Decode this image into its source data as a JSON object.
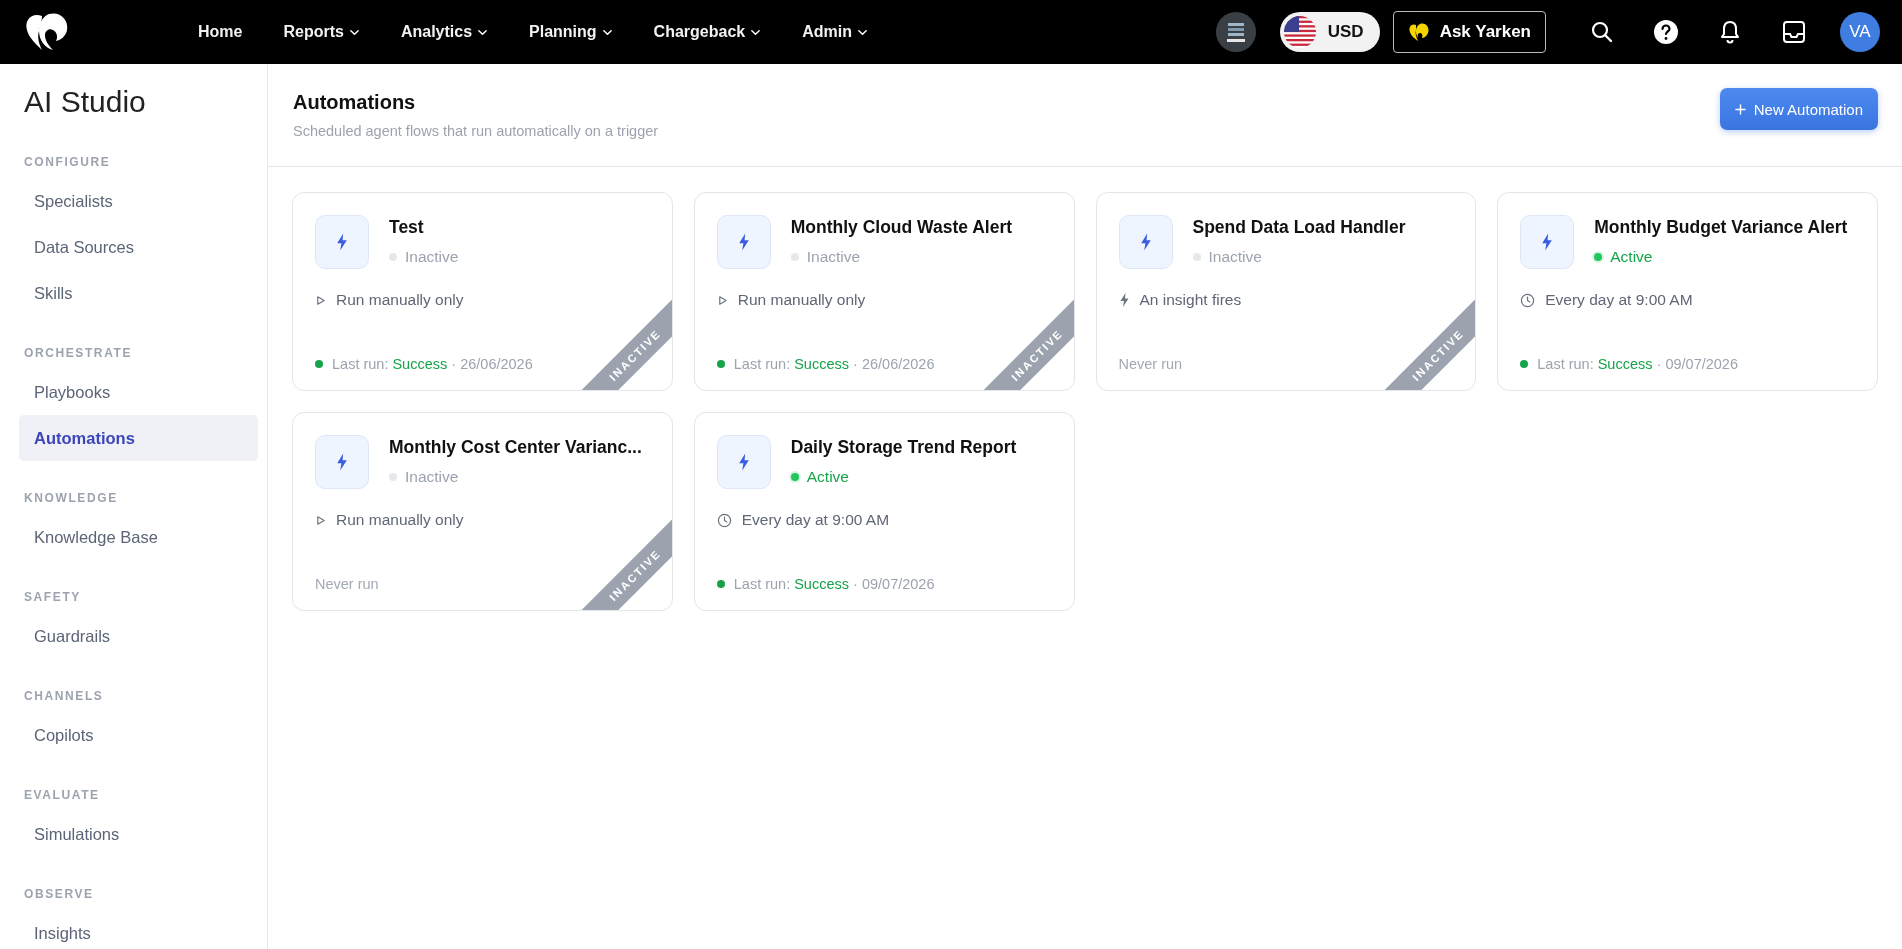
{
  "topbar": {
    "nav": [
      {
        "label": "Home",
        "dropdown": false
      },
      {
        "label": "Reports",
        "dropdown": true
      },
      {
        "label": "Analytics",
        "dropdown": true
      },
      {
        "label": "Planning",
        "dropdown": true
      },
      {
        "label": "Chargeback",
        "dropdown": true
      },
      {
        "label": "Admin",
        "dropdown": true
      }
    ],
    "currency": "USD",
    "assistant": "Ask Yarken",
    "avatar": "VA"
  },
  "sidebar": {
    "title": "AI Studio",
    "sections": [
      {
        "heading": "CONFIGURE",
        "items": [
          {
            "label": "Specialists",
            "selected": false
          },
          {
            "label": "Data Sources",
            "selected": false
          },
          {
            "label": "Skills",
            "selected": false
          }
        ]
      },
      {
        "heading": "ORCHESTRATE",
        "items": [
          {
            "label": "Playbooks",
            "selected": false
          },
          {
            "label": "Automations",
            "selected": true
          }
        ]
      },
      {
        "heading": "KNOWLEDGE",
        "items": [
          {
            "label": "Knowledge Base",
            "selected": false
          }
        ]
      },
      {
        "heading": "SAFETY",
        "items": [
          {
            "label": "Guardrails",
            "selected": false
          }
        ]
      },
      {
        "heading": "CHANNELS",
        "items": [
          {
            "label": "Copilots",
            "selected": false
          }
        ]
      },
      {
        "heading": "EVALUATE",
        "items": [
          {
            "label": "Simulations",
            "selected": false
          }
        ]
      },
      {
        "heading": "OBSERVE",
        "items": [
          {
            "label": "Insights",
            "selected": false
          }
        ]
      }
    ]
  },
  "page": {
    "title": "Automations",
    "subtitle": "Scheduled agent flows that run automatically on a trigger",
    "new_button": "New Automation"
  },
  "automations": [
    {
      "name": "Test",
      "status": {
        "kind": "inactive",
        "label": "Inactive"
      },
      "trigger": {
        "kind": "manual",
        "label": "Run manually only"
      },
      "last_run": {
        "kind": "success",
        "label": "Last run:",
        "result": "Success",
        "date": "· 26/06/2026"
      },
      "ribbon": "INACTIVE"
    },
    {
      "name": "Monthly Cloud Waste Alert",
      "status": {
        "kind": "inactive",
        "label": "Inactive"
      },
      "trigger": {
        "kind": "manual",
        "label": "Run manually only"
      },
      "last_run": {
        "kind": "success",
        "label": "Last run:",
        "result": "Success",
        "date": "· 26/06/2026"
      },
      "ribbon": "INACTIVE"
    },
    {
      "name": "Spend Data Load Handler",
      "status": {
        "kind": "inactive",
        "label": "Inactive"
      },
      "trigger": {
        "kind": "insight",
        "label": "An insight fires"
      },
      "last_run": {
        "kind": "never",
        "label": "Never run"
      },
      "ribbon": "INACTIVE"
    },
    {
      "name": "Monthly Budget Variance Alert",
      "status": {
        "kind": "active",
        "label": "Active"
      },
      "trigger": {
        "kind": "schedule",
        "label": "Every day at 9:00 AM"
      },
      "last_run": {
        "kind": "success",
        "label": "Last run:",
        "result": "Success",
        "date": "· 09/07/2026"
      }
    },
    {
      "name": "Monthly Cost Center Varianc...",
      "status": {
        "kind": "inactive",
        "label": "Inactive"
      },
      "trigger": {
        "kind": "manual",
        "label": "Run manually only"
      },
      "last_run": {
        "kind": "never",
        "label": "Never run"
      },
      "ribbon": "INACTIVE"
    },
    {
      "name": "Daily Storage Trend Report",
      "status": {
        "kind": "active",
        "label": "Active"
      },
      "trigger": {
        "kind": "schedule",
        "label": "Every day at 9:00 AM"
      },
      "last_run": {
        "kind": "success",
        "label": "Last run:",
        "result": "Success",
        "date": "· 09/07/2026"
      }
    }
  ]
}
